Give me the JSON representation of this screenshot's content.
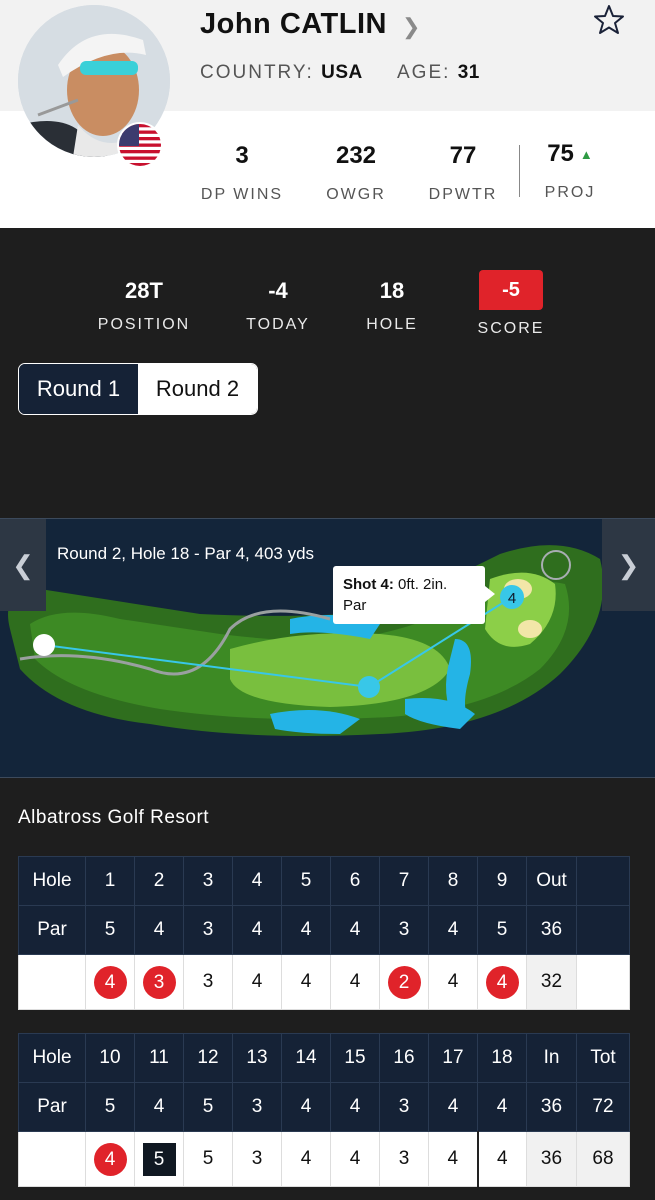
{
  "player": {
    "name": "John CATLIN",
    "country_label": "COUNTRY:",
    "country": "USA",
    "age_label": "AGE:",
    "age": "31"
  },
  "stats": [
    {
      "value": "3",
      "label": "DP WINS"
    },
    {
      "value": "232",
      "label": "OWGR"
    },
    {
      "value": "77",
      "label": "DPWTR"
    },
    {
      "value": "75",
      "label": "PROJ",
      "trend": "up"
    }
  ],
  "tournament": {
    "position": "28T",
    "position_label": "POSITION",
    "today": "-4",
    "today_label": "TODAY",
    "hole": "18",
    "hole_label": "HOLE",
    "score": "-5",
    "score_label": "SCORE"
  },
  "rounds": {
    "tabs": [
      "Round 1",
      "Round 2"
    ],
    "selected": "Round 1"
  },
  "map": {
    "title": "Round 2, Hole 18 - Par 4, 403 yds",
    "shot_label": "Shot 4:",
    "shot_distance": "0ft. 2in.",
    "shot_result": "Par",
    "marker_number": "4"
  },
  "course": "Albatross Golf Resort",
  "front_nine": {
    "hole_label": "Hole",
    "par_label": "Par",
    "holes": [
      "1",
      "2",
      "3",
      "4",
      "5",
      "6",
      "7",
      "8",
      "9"
    ],
    "total_label": "Out",
    "par": [
      "5",
      "4",
      "3",
      "4",
      "4",
      "4",
      "3",
      "4",
      "5"
    ],
    "par_total": "36",
    "scores": [
      "4",
      "3",
      "3",
      "4",
      "4",
      "4",
      "2",
      "4",
      "4"
    ],
    "score_total": "32"
  },
  "back_nine": {
    "hole_label": "Hole",
    "par_label": "Par",
    "holes": [
      "10",
      "11",
      "12",
      "13",
      "14",
      "15",
      "16",
      "17",
      "18"
    ],
    "in_label": "In",
    "tot_label": "Tot",
    "par": [
      "5",
      "4",
      "5",
      "3",
      "4",
      "4",
      "3",
      "4",
      "4"
    ],
    "par_in": "36",
    "par_tot": "72",
    "scores": [
      "4",
      "5",
      "5",
      "3",
      "4",
      "4",
      "3",
      "4",
      "4"
    ],
    "score_in": "36",
    "score_tot": "68"
  },
  "colors": {
    "accent_red": "#e0232a",
    "navy": "#152236",
    "trend_green": "#2e9a43"
  }
}
